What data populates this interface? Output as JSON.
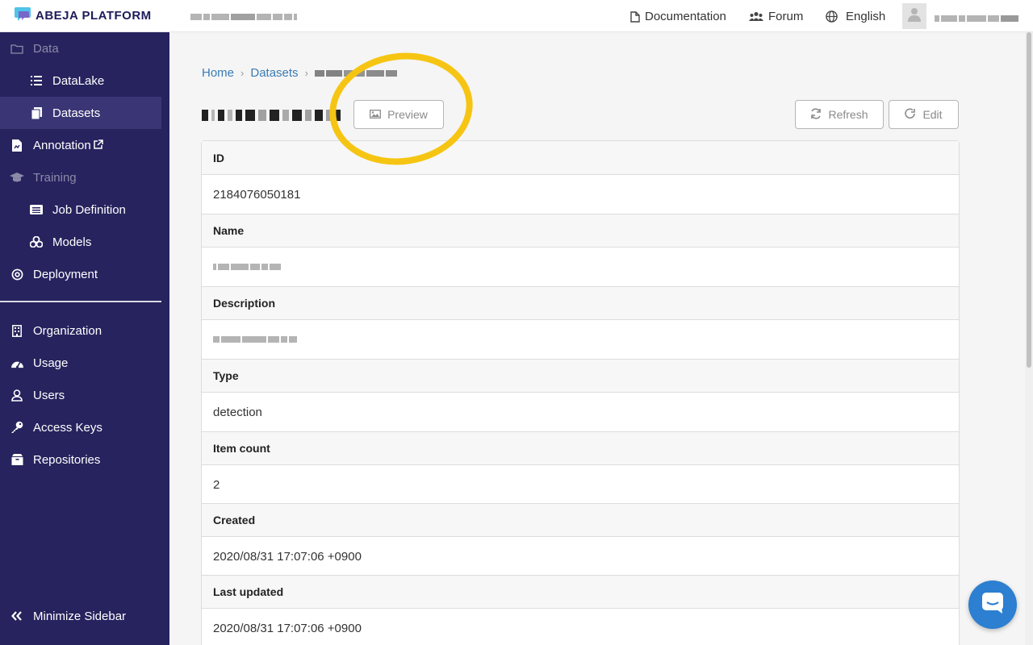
{
  "app": {
    "brand": "ABEJA PLATFORM",
    "brand_color": "#1e1c5a",
    "accent_color": "#27235e"
  },
  "header": {
    "links": [
      {
        "label": "Documentation",
        "icon": "file-icon"
      },
      {
        "label": "Forum",
        "icon": "users-icon"
      },
      {
        "label": "English",
        "icon": "globe-icon"
      }
    ],
    "avatar_icon": "user-icon"
  },
  "sidebar": {
    "items": [
      {
        "label": "Data",
        "icon": "folder-icon",
        "level": "top",
        "muted": true
      },
      {
        "label": "DataLake",
        "icon": "list-icon",
        "level": "sub"
      },
      {
        "label": "Datasets",
        "icon": "copy-icon",
        "level": "sub",
        "active": true
      },
      {
        "label": "Annotation",
        "icon": "annotation-icon",
        "level": "top",
        "external": true
      },
      {
        "label": "Training",
        "icon": "graduation-cap-icon",
        "level": "top",
        "muted": true
      },
      {
        "label": "Job Definition",
        "icon": "list-alt-icon",
        "level": "sub"
      },
      {
        "label": "Models",
        "icon": "cubes-icon",
        "level": "sub"
      },
      {
        "label": "Deployment",
        "icon": "target-icon",
        "level": "top"
      },
      {
        "label": "Organization",
        "icon": "building-icon",
        "level": "top"
      },
      {
        "label": "Usage",
        "icon": "gauge-icon",
        "level": "top"
      },
      {
        "label": "Users",
        "icon": "user-icon",
        "level": "top"
      },
      {
        "label": "Access Keys",
        "icon": "key-icon",
        "level": "top"
      },
      {
        "label": "Repositories",
        "icon": "box-icon",
        "level": "top"
      }
    ],
    "minimize_label": "Minimize Sidebar"
  },
  "breadcrumb": {
    "home": "Home",
    "datasets": "Datasets"
  },
  "toolbar": {
    "preview_label": "Preview",
    "refresh_label": "Refresh",
    "edit_label": "Edit"
  },
  "details": [
    {
      "label": "ID",
      "value": "2184076050181"
    },
    {
      "label": "Name",
      "value": ""
    },
    {
      "label": "Description",
      "value": ""
    },
    {
      "label": "Type",
      "value": "detection"
    },
    {
      "label": "Item count",
      "value": "2"
    },
    {
      "label": "Created",
      "value": "2020/08/31 17:07:06 +0900"
    },
    {
      "label": "Last updated",
      "value": "2020/08/31 17:07:06 +0900"
    }
  ],
  "annotation_ring_color": "#f6c513"
}
